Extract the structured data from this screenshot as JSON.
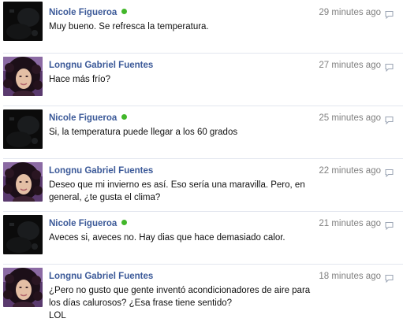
{
  "messages": [
    {
      "sender": "Nicole Figueroa",
      "online": true,
      "avatar": "dark-photo",
      "time": "29 minutes ago",
      "lines": [
        "Muy bueno. Se refresca la temperatura."
      ]
    },
    {
      "sender": "Longnu Gabriel Fuentes",
      "online": false,
      "avatar": "girl-curly-hair-photo",
      "time": "27 minutes ago",
      "lines": [
        "Hace más frío?"
      ]
    },
    {
      "sender": "Nicole Figueroa",
      "online": true,
      "avatar": "dark-photo",
      "time": "25 minutes ago",
      "lines": [
        "Si, la temperatura puede llegar a los 60 grados"
      ]
    },
    {
      "sender": "Longnu Gabriel Fuentes",
      "online": false,
      "avatar": "girl-curly-hair-photo",
      "time": "22 minutes ago",
      "lines": [
        "Deseo que mi invierno es así. Eso sería una maravilla. Pero, en",
        "general, ¿te gusta el clima?"
      ]
    },
    {
      "sender": "Nicole Figueroa",
      "online": true,
      "avatar": "dark-photo",
      "time": "21 minutes ago",
      "lines": [
        "Aveces si, aveces no. Hay dias que hace demasiado calor."
      ]
    },
    {
      "sender": "Longnu Gabriel Fuentes",
      "online": false,
      "avatar": "girl-curly-hair-photo",
      "time": "18 minutes ago",
      "lines": [
        "¿Pero no gusto que gente inventó acondicionadores de aire para",
        "los días calurosos? ¿Esa frase tiene sentido?",
        "LOL"
      ]
    }
  ],
  "colors": {
    "name": "#3b5998",
    "time": "#808080",
    "online": "#42b72a",
    "divider": "#e2e6ee"
  },
  "icons": {
    "reply": "reply-icon",
    "online": "online-dot-icon"
  }
}
